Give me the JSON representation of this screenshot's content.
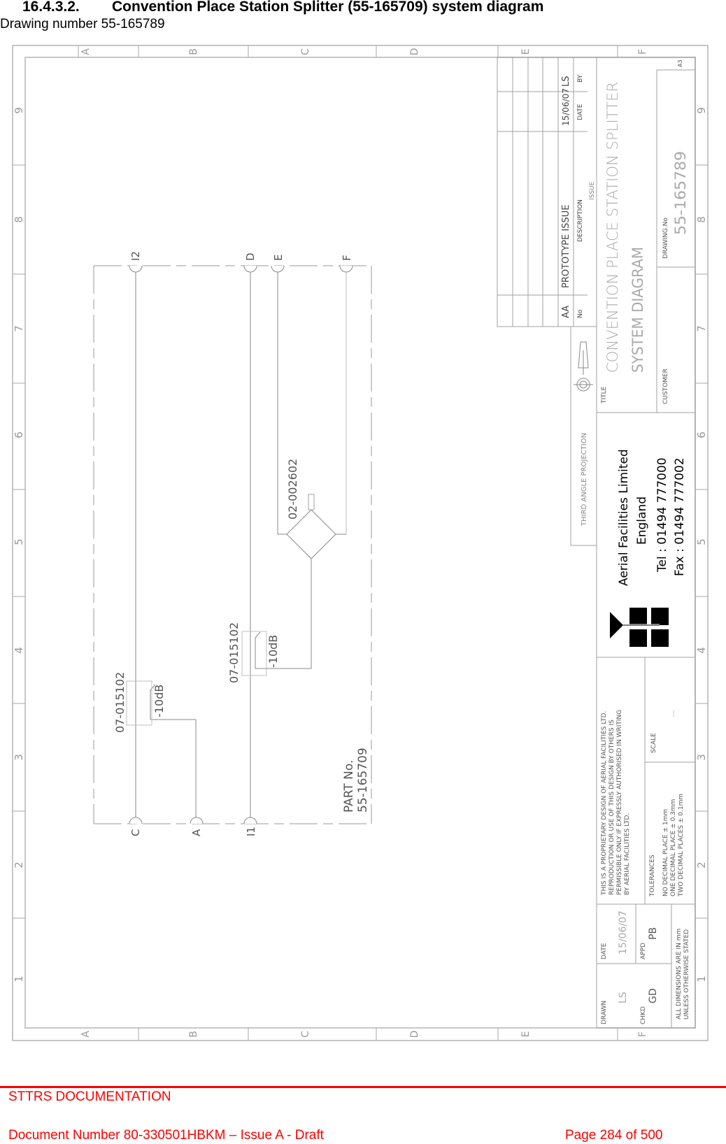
{
  "section": {
    "number": "16.4.3.2.",
    "title": "Convention Place Station Splitter (55-165709) system diagram",
    "subtitle": "Drawing number 55-165789"
  },
  "drawing": {
    "border_letters": [
      "A",
      "B",
      "C",
      "D",
      "E",
      "F"
    ],
    "border_numbers": [
      "1",
      "2",
      "3",
      "4",
      "5",
      "6",
      "7",
      "8",
      "9"
    ],
    "ports": {
      "top": [
        "I2",
        "D",
        "E",
        "F"
      ],
      "bottom": [
        "C",
        "A",
        "I1"
      ]
    },
    "components": [
      {
        "part": "07-015102",
        "label": "-10dB",
        "type": "directional-coupler"
      },
      {
        "part": "07-015102",
        "label": "-10dB",
        "type": "directional-coupler"
      },
      {
        "part": "02-002602",
        "label": "",
        "type": "splitter"
      }
    ],
    "part_no_label": "PART No.",
    "part_no": "55-165709",
    "title_block": {
      "revision_table": {
        "headers": {
          "no": "No",
          "description": "DESCRIPTION",
          "date": "DATE",
          "by": "BY"
        },
        "caption": "ISSUE",
        "rows": [
          {
            "no": "AA",
            "description": "PROTOTYPE ISSUE",
            "date": "15/06/07",
            "by": "LS"
          }
        ]
      },
      "projection": "THIRD ANGLE PROJECTION",
      "title_label": "TITLE",
      "title_line1": "CONVENTION PLACE STATION SPLITTER",
      "title_line2": "SYSTEM DIAGRAM",
      "customer_label": "CUSTOMER",
      "drawing_no_label": "DRAWING.No",
      "drawing_no": "55-165789",
      "sheet_size": "A3",
      "company": {
        "name": "Aerial Facilities Limited",
        "country": "England",
        "tel": "Tel : 01494 777000",
        "fax": "Fax : 01494 777002"
      },
      "proprietary_notice": [
        "THIS IS A PROPRIETARY DESIGN OF AERIAL FACILITIES LTD.",
        "REPRODUCTION OR USE OF THIS DESIGN BY OTHERS IS",
        "PERMISSIBLE ONLY IF EXPRESSLY AUTHORISED IN WRITING",
        "BY AERIAL FACILITIES LTD."
      ],
      "scale_label": "SCALE",
      "scale_value": "—",
      "tolerances_label": "TOLERANCES",
      "tolerances": [
        "NO DECIMAL PLACE ± 1mm",
        "ONE DECIMAL PLACE ± 0.3mm",
        "TWO DECIMAL PLACES ± 0.1mm"
      ],
      "drawn_label": "DRAWN",
      "drawn_by": "LS",
      "date_label": "DATE",
      "date_value": "15/06/07",
      "chkd_label": "CHKD",
      "chkd_by": "GD",
      "appd_label": "APPD",
      "appd_by": "PB",
      "dimensions_note": [
        "ALL DIMENSIONS ARE IN mm",
        "UNLESS OTHERWISE STATED"
      ]
    }
  },
  "footer": {
    "org": "STTRS DOCUMENTATION",
    "document": "Document Number 80-330501HBKM – Issue A - Draft",
    "page": "Page 284 of 500"
  }
}
